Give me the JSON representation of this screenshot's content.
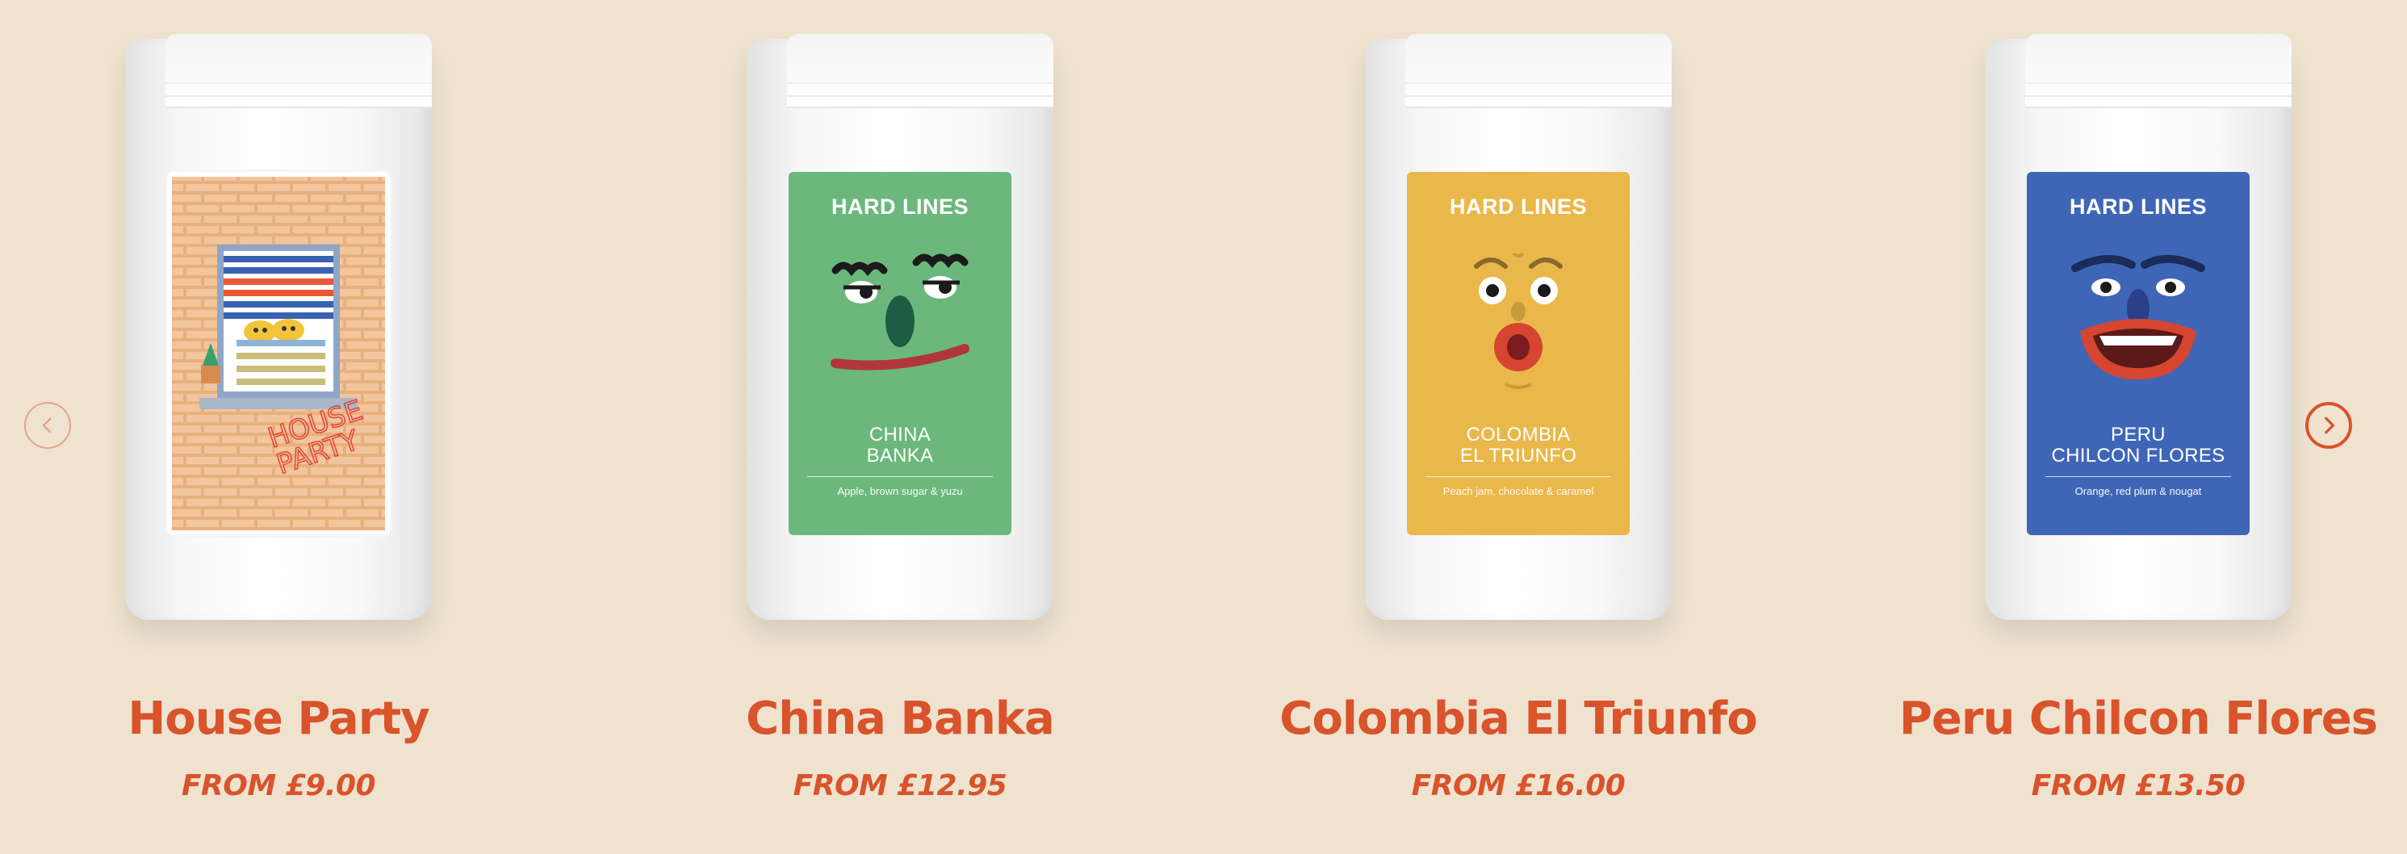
{
  "carousel": {
    "prev_icon": "chevron-left-icon",
    "next_icon": "chevron-right-icon",
    "products": [
      {
        "name": "House Party",
        "price": "FROM £9.00",
        "label_text": "HOUSE PARTY",
        "label_color": "#f2c49b"
      },
      {
        "name": "China Banka",
        "price": "FROM £12.95",
        "brand": "HARD LINES",
        "origin_line1": "CHINA",
        "origin_line2": "BANKA",
        "notes": "Apple, brown sugar & yuzu",
        "label_color": "#6cb87c"
      },
      {
        "name": "Colombia El Triunfo",
        "price": "FROM £16.00",
        "brand": "HARD LINES",
        "origin_line1": "COLOMBIA",
        "origin_line2": "EL TRIUNFO",
        "notes": "Peach jam, chocolate & caramel",
        "label_color": "#eab84a"
      },
      {
        "name": "Peru Chilcon Flores",
        "price": "FROM £13.50",
        "brand": "HARD LINES",
        "origin_line1": "PERU",
        "origin_line2": "CHILCON FLORES",
        "notes": "Orange, red plum & nougat",
        "label_color": "#3f66b6"
      }
    ]
  },
  "colors": {
    "background": "#efe3d0",
    "accent": "#d9532b"
  }
}
